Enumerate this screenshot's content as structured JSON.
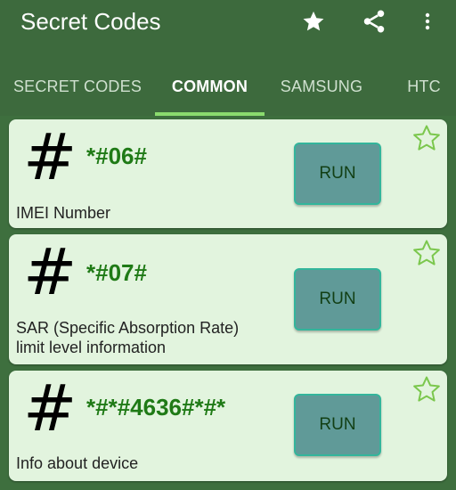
{
  "app": {
    "title": "Secret Codes",
    "bar_color": "#3d6a3d",
    "accent": "#8bdc6e",
    "icons": [
      "star-icon",
      "share-icon",
      "more-vert-icon"
    ]
  },
  "tabs": [
    {
      "label": "SECRET CODES",
      "active": false
    },
    {
      "label": "COMMON",
      "active": true
    },
    {
      "label": "SAMSUNG",
      "active": false
    },
    {
      "label": "HTC",
      "active": false
    }
  ],
  "cards": [
    {
      "symbol": "#",
      "code": "*#06#",
      "description_lines": [
        "IMEI Number"
      ],
      "run_label": "RUN",
      "favorite_icon": "star-outline-icon"
    },
    {
      "symbol": "#",
      "code": "*#07#",
      "description_lines": [
        "SAR (Specific Absorption Rate)",
        "limit level information"
      ],
      "run_label": "RUN",
      "favorite_icon": "star-outline-icon"
    },
    {
      "symbol": "#",
      "code": "*#*#4636#*#*",
      "description_lines": [
        "Info about device"
      ],
      "run_label": "RUN",
      "favorite_icon": "star-outline-icon"
    }
  ]
}
